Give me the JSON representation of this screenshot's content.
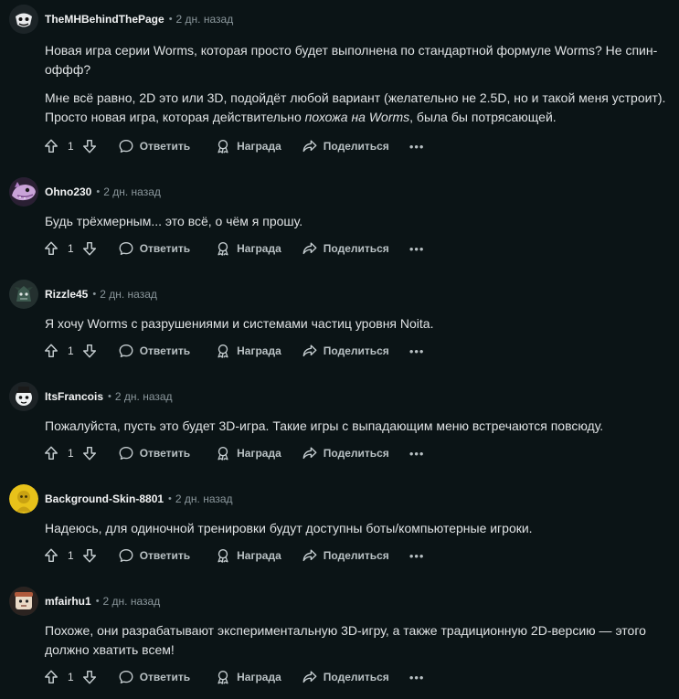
{
  "comments": [
    {
      "author": "TheMHBehindThePage",
      "time": "2 дн. назад",
      "p1": "Новая игра серии Worms, которая просто будет выполнена по стандартной формуле Worms? Не спин-оффф?",
      "p2a": "Мне всё равно, 2D это или 3D, подойдёт любой вариант (желательно не 2.5D, но и такой меня устроит).",
      "p2b": "Просто новая игра, которая действительно ",
      "p2c": "похожа на Worms",
      "p2d": ", была бы потрясающей.",
      "votes": "1"
    },
    {
      "author": "Ohno230",
      "time": "2 дн. назад",
      "text": "Будь трёхмерным... это всё, о чём я прошу.",
      "votes": "1"
    },
    {
      "author": "Rizzle45",
      "time": "2 дн. назад",
      "text": "Я хочу Worms с разрушениями и системами частиц уровня Noita.",
      "votes": "1"
    },
    {
      "author": "ItsFrancois",
      "time": "2 дн. назад",
      "text": "Пожалуйста, пусть это будет 3D-игра. Такие игры с выпадающим меню встречаются повсюду.",
      "votes": "1"
    },
    {
      "author": "Background-Skin-8801",
      "time": "2 дн. назад",
      "text": "Надеюсь, для одиночной тренировки будут доступны боты/компьютерные игроки.",
      "votes": "1"
    },
    {
      "author": "mfairhu1",
      "time": "2 дн. назад",
      "text1": "Похоже, они разрабатывают экспериментальную 3D-игру, а также традиционную 2D-версию — этого",
      "text2": "должно хватить всем!",
      "votes": "1"
    }
  ],
  "actions": {
    "reply": "Ответить",
    "award": "Награда",
    "share": "Поделиться",
    "more": "•••"
  },
  "separator": "•",
  "colors": {
    "background": "#0b1416",
    "text": "#d7dadc",
    "muted": "#8b979c"
  },
  "icons": [
    "upvote-icon",
    "downvote-icon",
    "reply-bubble-icon",
    "award-icon",
    "share-arrow-icon",
    "more-dots-icon"
  ]
}
